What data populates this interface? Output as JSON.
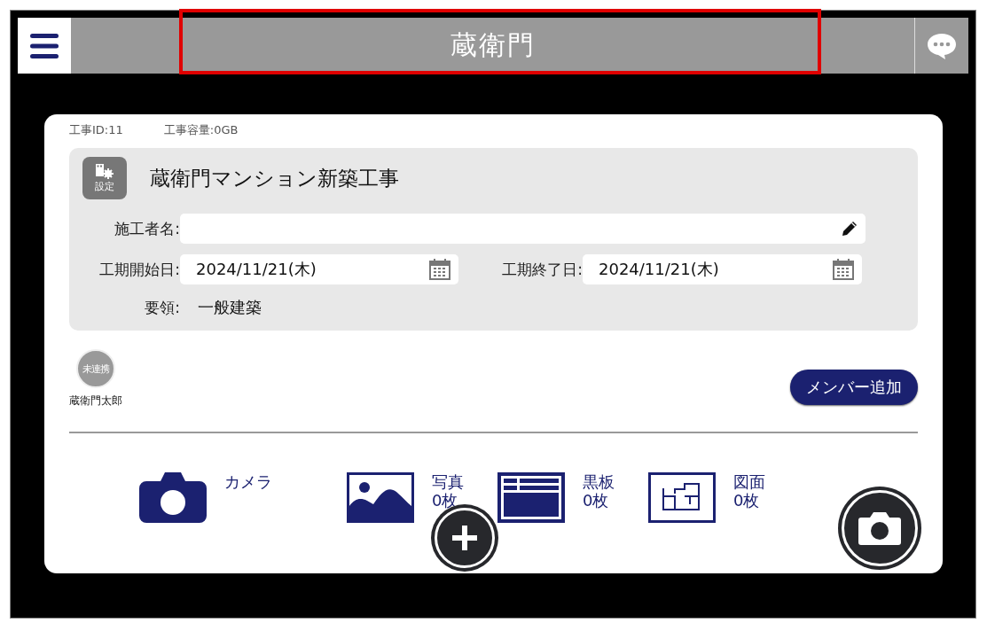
{
  "header": {
    "logo": "蔵衛門"
  },
  "project": {
    "id_label": "工事ID:11",
    "capacity_label": "工事容量:0GB",
    "settings_label": "設定",
    "title": "蔵衛門マンション新築工事",
    "builder": {
      "label": "施工者名:"
    },
    "start": {
      "label": "工期開始日:",
      "value": "2024/11/21(木)"
    },
    "end": {
      "label": "工期終了日:",
      "value": "2024/11/21(木)"
    },
    "guideline": {
      "label": "要領:",
      "value": "一般建築"
    }
  },
  "members": [
    {
      "status": "未連携",
      "name": "蔵衛門太郎"
    }
  ],
  "add_member_button": "メンバー追加",
  "tiles": [
    {
      "kind": "camera",
      "label": "カメラ"
    },
    {
      "kind": "photo",
      "label": "写真",
      "count": "0枚"
    },
    {
      "kind": "board",
      "label": "黒板",
      "count": "0枚"
    },
    {
      "kind": "drawing",
      "label": "図面",
      "count": "0枚"
    }
  ]
}
